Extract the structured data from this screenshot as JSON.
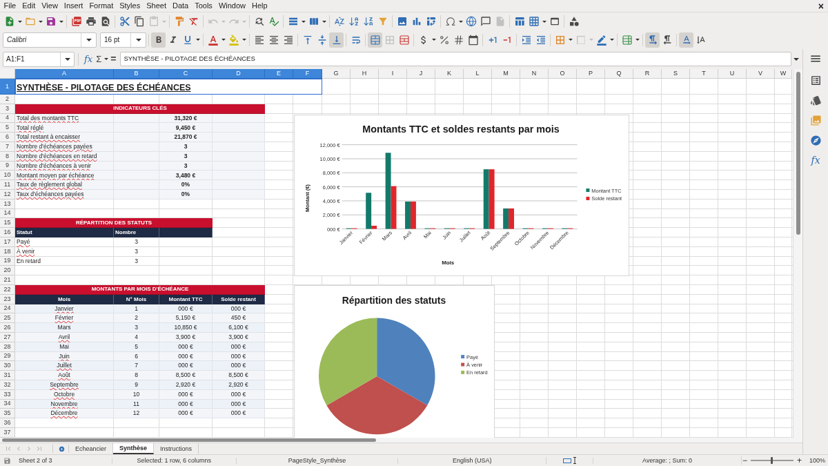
{
  "menu_bar": {
    "items": [
      "File",
      "Edit",
      "View",
      "Insert",
      "Format",
      "Styles",
      "Sheet",
      "Data",
      "Tools",
      "Window",
      "Help"
    ],
    "close": "×"
  },
  "standard_toolbar": {
    "paste_disabled": true,
    "undo_disabled": true,
    "redo_disabled": true,
    "header_footer_disabled": true
  },
  "formatting_toolbar": {
    "font_name": "Calibri",
    "font_size": "16 pt",
    "bold": true,
    "italic": false,
    "underline": false,
    "align_left": false,
    "align_center": false,
    "align_right": false,
    "align_top": false,
    "align_middle": false,
    "align_bottom": true,
    "wrap_text": false,
    "merge_and_center": true,
    "merge_cells_disabled": true,
    "border_style_disabled": true,
    "left_to_right": true,
    "right_to_left": false,
    "text_horizontal": true,
    "text_vertical": false
  },
  "formula_bar": {
    "name_box": "A1:F1",
    "function_wizard": "fx",
    "sum": "Σ",
    "equals": "=",
    "content": "SYNTHÈSE - PILOTAGE DES ÉCHÉANCES"
  },
  "sidebar": {
    "functions": "fx"
  },
  "sheet": {
    "columns": [
      {
        "label": "A",
        "selected": true
      },
      {
        "label": "B",
        "selected": true
      },
      {
        "label": "C",
        "selected": true
      },
      {
        "label": "D",
        "selected": true
      },
      {
        "label": "E",
        "selected": true
      },
      {
        "label": "F",
        "selected": true
      },
      {
        "label": "G",
        "selected": false
      },
      {
        "label": "H",
        "selected": false
      },
      {
        "label": "I",
        "selected": false
      },
      {
        "label": "J",
        "selected": false
      },
      {
        "label": "K",
        "selected": false
      },
      {
        "label": "L",
        "selected": false
      },
      {
        "label": "M",
        "selected": false
      },
      {
        "label": "N",
        "selected": false
      },
      {
        "label": "O",
        "selected": false
      },
      {
        "label": "P",
        "selected": false
      },
      {
        "label": "Q",
        "selected": false
      },
      {
        "label": "R",
        "selected": false
      },
      {
        "label": "S",
        "selected": false
      },
      {
        "label": "T",
        "selected": false
      },
      {
        "label": "U",
        "selected": false
      },
      {
        "label": "V",
        "selected": false
      },
      {
        "label": "W",
        "selected": false
      }
    ],
    "rows": [
      {
        "label": "1",
        "selected": true
      },
      {
        "label": "2",
        "selected": false
      },
      {
        "label": "3",
        "selected": false
      },
      {
        "label": "4",
        "selected": false
      },
      {
        "label": "5",
        "selected": false
      },
      {
        "label": "6",
        "selected": false
      },
      {
        "label": "7",
        "selected": false
      },
      {
        "label": "8",
        "selected": false
      },
      {
        "label": "9",
        "selected": false
      },
      {
        "label": "10",
        "selected": false
      },
      {
        "label": "11",
        "selected": false
      },
      {
        "label": "12",
        "selected": false
      },
      {
        "label": "13",
        "selected": false
      },
      {
        "label": "14",
        "selected": false
      },
      {
        "label": "15",
        "selected": false
      },
      {
        "label": "16",
        "selected": false
      },
      {
        "label": "17",
        "selected": false
      },
      {
        "label": "18",
        "selected": false
      },
      {
        "label": "19",
        "selected": false
      },
      {
        "label": "20",
        "selected": false
      },
      {
        "label": "21",
        "selected": false
      },
      {
        "label": "22",
        "selected": false
      },
      {
        "label": "23",
        "selected": false
      },
      {
        "label": "24",
        "selected": false
      },
      {
        "label": "25",
        "selected": false
      },
      {
        "label": "26",
        "selected": false
      },
      {
        "label": "27",
        "selected": false
      },
      {
        "label": "28",
        "selected": false
      },
      {
        "label": "29",
        "selected": false
      },
      {
        "label": "30",
        "selected": false
      },
      {
        "label": "31",
        "selected": false
      },
      {
        "label": "32",
        "selected": false
      },
      {
        "label": "33",
        "selected": false
      },
      {
        "label": "34",
        "selected": false
      },
      {
        "label": "35",
        "selected": false
      },
      {
        "label": "36",
        "selected": false
      },
      {
        "label": "37",
        "selected": false
      }
    ],
    "title": {
      "text": "SYNTHÈSE - PILOTAGE DES ÉCHÉANCES",
      "selected": true
    },
    "indicators": {
      "heading": "INDICATEURS CLÉS",
      "rows": [
        {
          "label": "Total des montants TTC",
          "value": "31,320 €",
          "spelling_error": true
        },
        {
          "label": "Total réglé",
          "value": "9,450 €",
          "spelling_error": true
        },
        {
          "label": "Total restant à encaisser",
          "value": "21,870 €",
          "spelling_error": true
        },
        {
          "label": "Nombre d'échéances payées",
          "value": "3",
          "spelling_error": true
        },
        {
          "label": "Nombre d'échéances en retard",
          "value": "3",
          "spelling_error": true
        },
        {
          "label": "Nombre d'échéances à venir",
          "value": "3",
          "spelling_error": true
        },
        {
          "label": "Montant moyen par échéance",
          "value": "3,480 €",
          "spelling_error": true
        },
        {
          "label": "Taux de règlement global",
          "value": "0%",
          "spelling_error": true
        },
        {
          "label": "Taux d'échéances payées",
          "value": "0%",
          "spelling_error": true
        }
      ]
    },
    "status_table": {
      "heading": "RÉPARTITION DES STATUTS",
      "columns": [
        "Statut",
        "Nombre"
      ],
      "rows": [
        {
          "label": "Payé",
          "value": "3",
          "spelling_error": true
        },
        {
          "label": "À venir",
          "value": "3",
          "spelling_error": true
        },
        {
          "label": "En retard",
          "value": "3",
          "spelling_error": false
        }
      ]
    },
    "monthly_table": {
      "heading": "MONTANTS PAR MOIS D'ÉCHÉANCE",
      "columns": [
        "Mois",
        "N° Mois",
        "Montant TTC",
        "Solde restant"
      ],
      "rows": [
        {
          "month": "Janvier",
          "spelling_error": true,
          "number": "1",
          "amount": "000 €",
          "balance": "000 €"
        },
        {
          "month": "Février",
          "spelling_error": true,
          "number": "2",
          "amount": "5,150 €",
          "balance": "450 €"
        },
        {
          "month": "Mars",
          "spelling_error": false,
          "number": "3",
          "amount": "10,850 €",
          "balance": "6,100 €"
        },
        {
          "month": "Avril",
          "spelling_error": true,
          "number": "4",
          "amount": "3,900 €",
          "balance": "3,900 €"
        },
        {
          "month": "Mai",
          "spelling_error": false,
          "number": "5",
          "amount": "000 €",
          "balance": "000 €"
        },
        {
          "month": "Juin",
          "spelling_error": true,
          "number": "6",
          "amount": "000 €",
          "balance": "000 €"
        },
        {
          "month": "Juillet",
          "spelling_error": true,
          "number": "7",
          "amount": "000 €",
          "balance": "000 €"
        },
        {
          "month": "Août",
          "spelling_error": true,
          "number": "8",
          "amount": "8,500 €",
          "balance": "8,500 €"
        },
        {
          "month": "Septembre",
          "spelling_error": true,
          "number": "9",
          "amount": "2,920 €",
          "balance": "2,920 €"
        },
        {
          "month": "Octobre",
          "spelling_error": true,
          "number": "10",
          "amount": "000 €",
          "balance": "000 €"
        },
        {
          "month": "Novembre",
          "spelling_error": true,
          "number": "11",
          "amount": "000 €",
          "balance": "000 €"
        },
        {
          "month": "Décembre",
          "spelling_error": true,
          "number": "12",
          "amount": "000 €",
          "balance": "000 €"
        }
      ]
    }
  },
  "bar_chart": {
    "chart_data": {
      "type": "bar",
      "title": "Montants TTC et soldes restants par mois",
      "xlabel": "Mois",
      "ylabel": "Montant (€)",
      "categories": [
        "Janvier",
        "Février",
        "Mars",
        "Avril",
        "Mai",
        "Juin",
        "Juillet",
        "Août",
        "Septembre",
        "Octobre",
        "Novembre",
        "Décembre"
      ],
      "series": [
        {
          "name": "Montant TTC",
          "color": "#137a6b",
          "values": [
            0,
            5150,
            10850,
            3900,
            0,
            0,
            0,
            8500,
            2920,
            0,
            0,
            0
          ]
        },
        {
          "name": "Solde restant",
          "color": "#e0262c",
          "values": [
            0,
            450,
            6100,
            3900,
            0,
            0,
            0,
            8500,
            2920,
            0,
            0,
            0
          ]
        }
      ],
      "ylim": [
        0,
        12000
      ],
      "yticks": [
        {
          "value": 0,
          "label": "000 €"
        },
        {
          "value": 2000,
          "label": "2,000 €"
        },
        {
          "value": 4000,
          "label": "4,000 €"
        },
        {
          "value": 6000,
          "label": "6,000 €"
        },
        {
          "value": 8000,
          "label": "8,000 €"
        },
        {
          "value": 10000,
          "label": "10,000 €"
        },
        {
          "value": 12000,
          "label": "12,000 €"
        }
      ],
      "grid": true,
      "legend": "right"
    }
  },
  "pie_chart": {
    "chart_data": {
      "type": "pie",
      "title": "Répartition des statuts",
      "categories": [
        "Payé",
        "À venir",
        "En retard"
      ],
      "values": [
        33.3,
        33.3,
        33.4
      ],
      "colors": [
        "#4f81bd",
        "#c0504d",
        "#9bbb59"
      ],
      "legend": "right"
    }
  },
  "sheet_tabs": {
    "navigation_disabled": true,
    "tabs": [
      {
        "label": "Echeancier",
        "selected": false
      },
      {
        "label": "Synthèse",
        "selected": true
      },
      {
        "label": "Instructions",
        "selected": false
      }
    ]
  },
  "status_bar": {
    "sheet": "Sheet 2 of 3",
    "selection": "Selected: 1 row, 6 columns",
    "page_style": "PageStyle_Synthèse",
    "language": "English (USA)",
    "summary": "Average: ; Sum: 0",
    "zoom_out": "−",
    "zoom_slider": {
      "level": 0.5
    },
    "zoom_in": "+",
    "zoom": "100%"
  }
}
